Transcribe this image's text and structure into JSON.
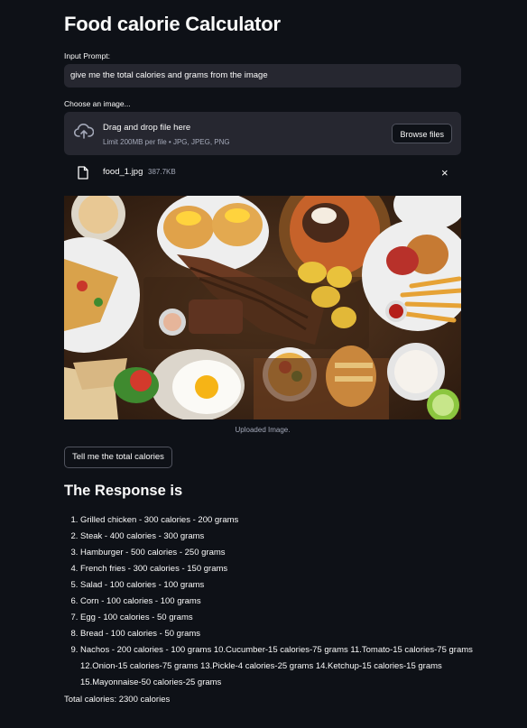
{
  "title": "Food calorie Calculator",
  "prompt": {
    "label": "Input Prompt:",
    "value": "give me the total calories and grams from the image"
  },
  "uploader": {
    "label": "Choose an image...",
    "drop_title": "Drag and drop file here",
    "drop_subtitle": "Limit 200MB per file • JPG, JPEG, PNG",
    "browse_label": "Browse files",
    "file_name": "food_1.jpg",
    "file_size": "387.7KB",
    "close_glyph": "×",
    "icons": [
      "cloud-upload-icon",
      "file-icon",
      "close-icon"
    ]
  },
  "image": {
    "caption": "Uploaded Image."
  },
  "submit_label": "Tell me the total calories",
  "response": {
    "heading": "The Response is",
    "items": [
      "Grilled chicken - 300 calories - 200 grams",
      "Steak - 400 calories - 300 grams",
      "Hamburger - 500 calories - 250 grams",
      "French fries - 300 calories - 150 grams",
      "Salad - 100 calories - 100 grams",
      "Corn - 100 calories - 100 grams",
      "Egg - 100 calories - 50 grams",
      "Bread - 100 calories - 50 grams",
      "Nachos - 200 calories - 100 grams 10.Cucumber-15 calories-75 grams 11.Tomato-15 calories-75 grams 12.Onion-15 calories-75 grams 13.Pickle-4 calories-25 grams 14.Ketchup-15 calories-15 grams 15.Mayonnaise-50 calories-25 grams"
    ],
    "total": "Total calories: 2300 calories"
  }
}
